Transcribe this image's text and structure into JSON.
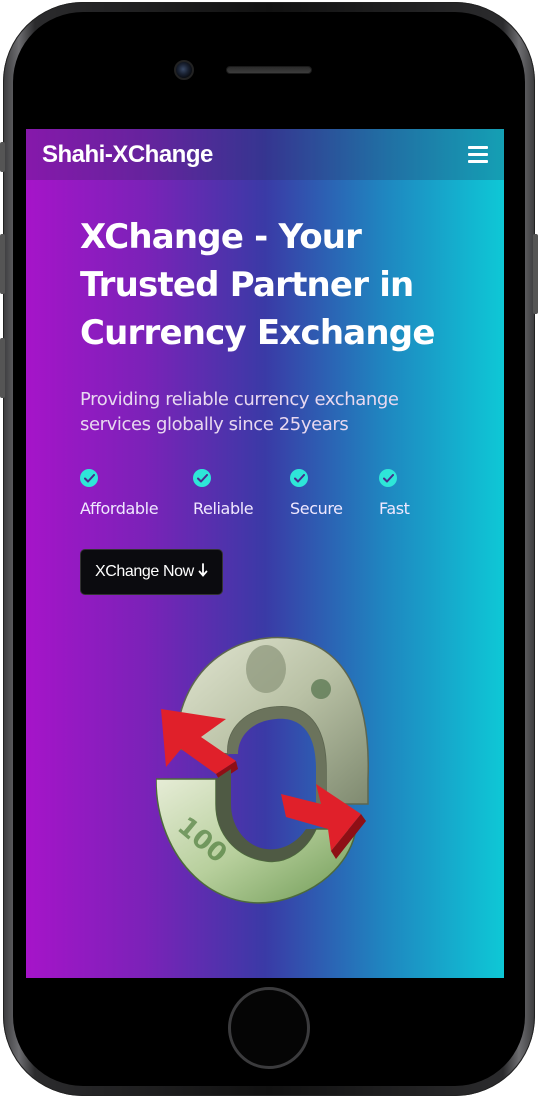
{
  "navbar": {
    "brand": "Shahi-XChange",
    "menu_icon": "hamburger-menu-icon"
  },
  "hero": {
    "title": "XChange - Your Trusted Partner in Currency Exchange",
    "subtitle": "Providing reliable currency exchange services globally since 25years",
    "features": [
      {
        "label": "Affordable",
        "icon": "check-circle-icon"
      },
      {
        "label": "Reliable",
        "icon": "check-circle-icon"
      },
      {
        "label": "Secure",
        "icon": "check-circle-icon"
      },
      {
        "label": "Fast",
        "icon": "check-circle-icon"
      }
    ],
    "cta_label": "XChange Now",
    "cta_icon": "arrow-down-icon",
    "image": "currency-exchange-arrows-image"
  },
  "colors": {
    "gradient_start": "#a614c9",
    "gradient_mid": "#3a3aa6",
    "gradient_end": "#0ec8d6",
    "check_color": "#2ee6d8",
    "cta_bg": "#0b0b0f"
  }
}
